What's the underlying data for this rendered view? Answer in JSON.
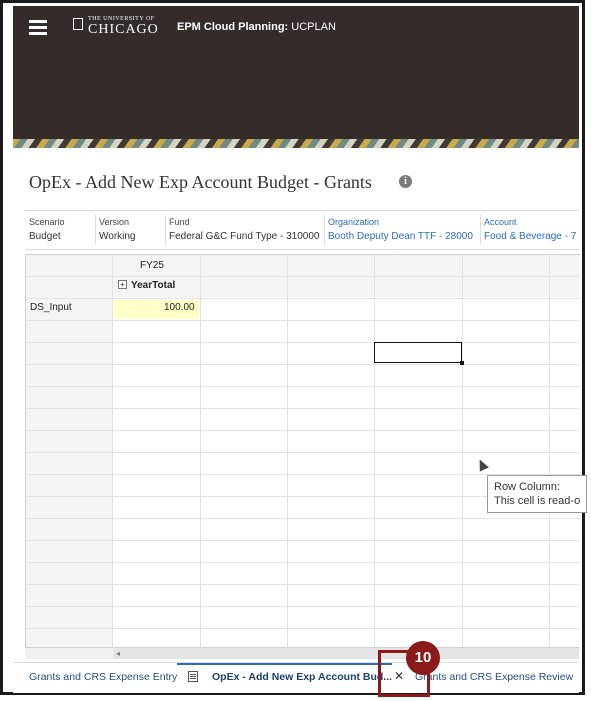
{
  "header": {
    "logo_small": "THE UNIVERSITY OF",
    "logo_big": "CHICAGO",
    "app_title_bold": "EPM Cloud Planning:",
    "app_title_rest": " UCPLAN"
  },
  "page": {
    "title": "OpEx - Add New Exp Account Budget - Grants"
  },
  "pov": [
    {
      "label": "Scenario",
      "value": "Budget"
    },
    {
      "label": "Version",
      "value": "Working"
    },
    {
      "label": "Fund",
      "value": "Federal G&C Fund Type - 310000"
    },
    {
      "label": "Organization",
      "value": "Booth Deputy Dean TTF - 28000"
    },
    {
      "label": "Account",
      "value": "Food & Beverage - 7"
    }
  ],
  "grid": {
    "col_header_1": "FY25",
    "col_header_2": "YearTotal",
    "row_header": "DS_Input",
    "cell_value": "100.00"
  },
  "tooltip": {
    "line1": "Row  Column:",
    "line2": "This cell is read-o"
  },
  "tabs": {
    "tab1": "Grants and CRS Expense Entry",
    "tab2": "OpEx - Add New Exp Account Bud...",
    "tab3": "Grants and CRS Expense Review"
  },
  "callout": {
    "number": "10",
    "color": "#8b1b1b"
  }
}
